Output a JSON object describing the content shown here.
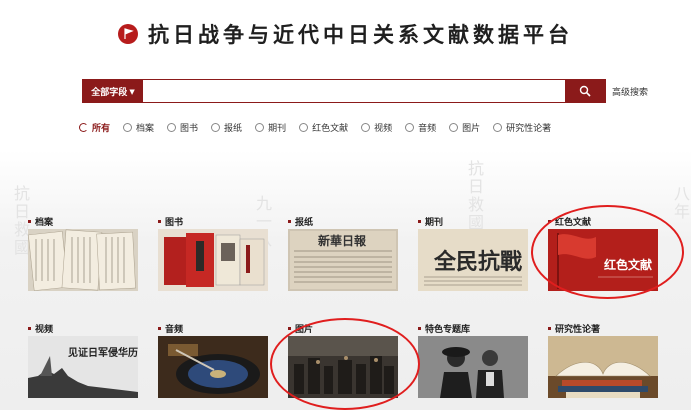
{
  "header": {
    "title": "抗日战争与近代中日关系文献数据平台",
    "logo": "flag-logo-icon"
  },
  "search": {
    "scope_label": "全部字段",
    "placeholder": "",
    "value": "",
    "button_icon": "search-icon",
    "advanced_label": "高级搜索"
  },
  "filters": [
    {
      "label": "所有",
      "selected": true
    },
    {
      "label": "档案",
      "selected": false
    },
    {
      "label": "图书",
      "selected": false
    },
    {
      "label": "报纸",
      "selected": false
    },
    {
      "label": "期刊",
      "selected": false
    },
    {
      "label": "红色文献",
      "selected": false
    },
    {
      "label": "视频",
      "selected": false
    },
    {
      "label": "音频",
      "selected": false
    },
    {
      "label": "图片",
      "selected": false
    },
    {
      "label": "研究性论著",
      "selected": false
    }
  ],
  "categories": [
    {
      "label": "档案"
    },
    {
      "label": "图书"
    },
    {
      "label": "报纸"
    },
    {
      "label": "期刊"
    },
    {
      "label": "红色文献",
      "thumb_text": "红色文献"
    },
    {
      "label": "视频",
      "thumb_text": "见证日军侵华历史"
    },
    {
      "label": "音频"
    },
    {
      "label": "图片"
    },
    {
      "label": "特色专题库"
    },
    {
      "label": "研究性论著"
    }
  ],
  "thumb_texts": {
    "newspaper_masthead": "新華日報",
    "journal_title": "全民抗戰"
  },
  "colors": {
    "brand": "#8b1a1a",
    "annotation": "#e01e1e"
  }
}
